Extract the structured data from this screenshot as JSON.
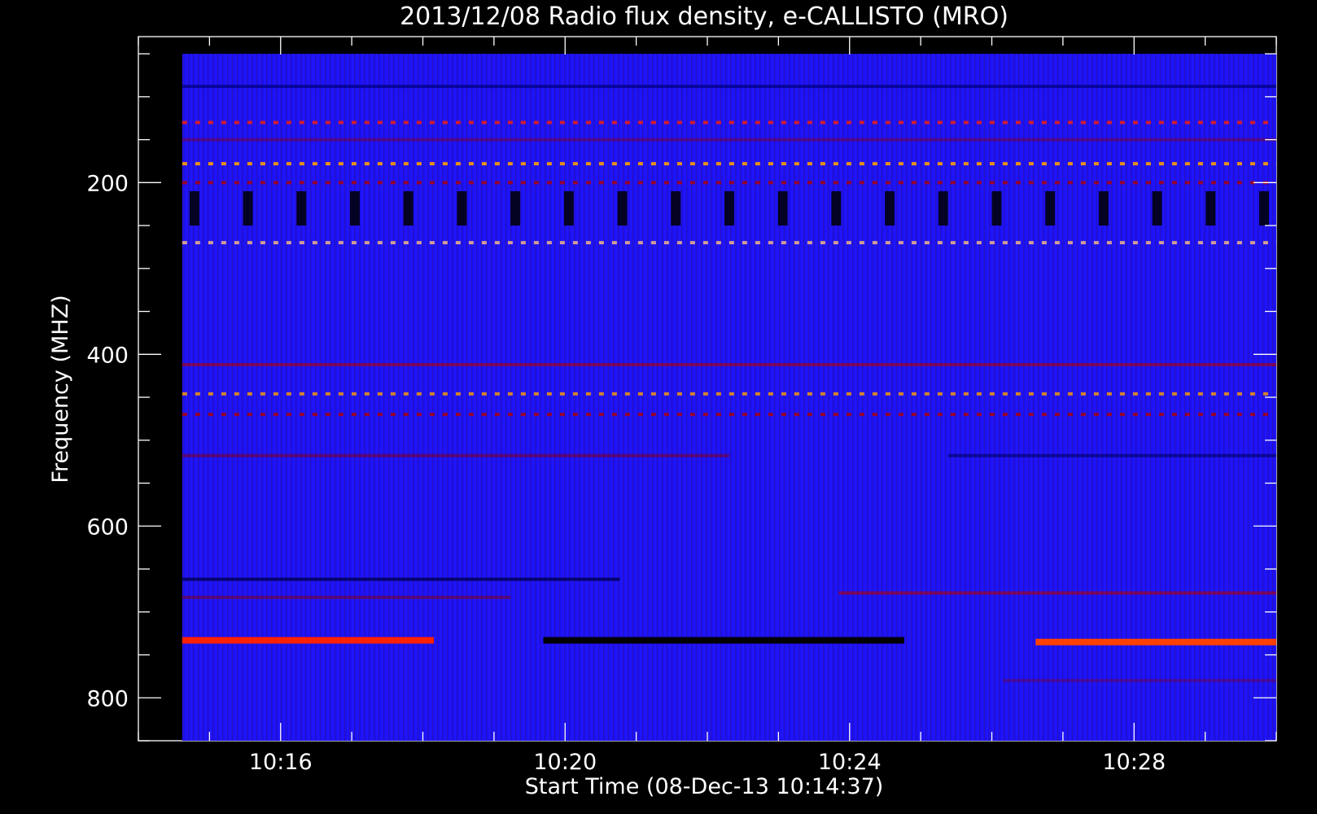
{
  "chart_data": {
    "type": "heatmap",
    "title": "2013/12/08  Radio flux density, e-CALLISTO (MRO)",
    "xlabel": "Start Time (08-Dec-13 10:14:37)",
    "ylabel": "Frequency (MHZ)",
    "x_ticks": [
      "10:16",
      "10:20",
      "10:24",
      "10:28"
    ],
    "y_ticks": [
      "200",
      "400",
      "600",
      "800"
    ],
    "x_range_minutes": [
      10.0,
      10.5
    ],
    "time_range": [
      "10:14:37",
      "10:30:00"
    ],
    "xlim": [
      "10:14:00",
      "10:30:00"
    ],
    "ylim": [
      850,
      30
    ],
    "data_freq_range": [
      850,
      50
    ],
    "y_reversed": true,
    "grid": false,
    "colormap": [
      "#000000",
      "#0000ff",
      "#b30000",
      "#ff2000",
      "#ffa000",
      "#ffffff"
    ],
    "background_color": "#1a10f0",
    "bands": [
      {
        "freq": 88,
        "color": "#00007a",
        "intensity": 0.7,
        "extent": [
          0,
          1
        ]
      },
      {
        "freq": 130,
        "color": "#ff2000",
        "intensity": 0.8,
        "extent": [
          0,
          1
        ],
        "dashed": true
      },
      {
        "freq": 150,
        "color": "#7a0030",
        "intensity": 0.5,
        "extent": [
          0,
          1
        ]
      },
      {
        "freq": 178,
        "color": "#ffa000",
        "intensity": 0.9,
        "extent": [
          0,
          1
        ],
        "dashed": true
      },
      {
        "freq": 200,
        "color": "#b30000",
        "intensity": 0.8,
        "extent": [
          0,
          1
        ],
        "dashed": true
      },
      {
        "freq": 270,
        "color": "#ffc080",
        "intensity": 0.8,
        "extent": [
          0,
          1
        ],
        "dashed": true
      },
      {
        "freq": 412,
        "color": "#b30000",
        "intensity": 0.6,
        "extent": [
          0,
          1
        ]
      },
      {
        "freq": 446,
        "color": "#ffa000",
        "intensity": 0.8,
        "extent": [
          0,
          1
        ],
        "dashed": true
      },
      {
        "freq": 470,
        "color": "#b30000",
        "intensity": 0.8,
        "extent": [
          0,
          1
        ],
        "dashed": true
      },
      {
        "freq": 518,
        "color": "#7a0030",
        "intensity": 0.6,
        "extent": [
          0,
          0.5
        ]
      },
      {
        "freq": 518,
        "color": "#000060",
        "intensity": 0.6,
        "extent": [
          0.7,
          1
        ]
      },
      {
        "freq": 662,
        "color": "#000050",
        "intensity": 0.8,
        "extent": [
          0,
          0.4
        ]
      },
      {
        "freq": 678,
        "color": "#b30000",
        "intensity": 0.6,
        "extent": [
          0.6,
          1
        ]
      },
      {
        "freq": 683,
        "color": "#7a0030",
        "intensity": 0.6,
        "extent": [
          0,
          0.3
        ]
      },
      {
        "freq": 733,
        "color": "#ff2000",
        "intensity": 1.0,
        "extent": [
          0,
          0.23
        ]
      },
      {
        "freq": 733,
        "color": "#000000",
        "intensity": 1.0,
        "extent": [
          0.33,
          0.66
        ]
      },
      {
        "freq": 735,
        "color": "#ff4000",
        "intensity": 1.0,
        "extent": [
          0.78,
          1
        ]
      },
      {
        "freq": 780,
        "color": "#7a0030",
        "intensity": 0.4,
        "extent": [
          0.75,
          1
        ]
      }
    ],
    "dark_bursts": {
      "freq_range": [
        210,
        250
      ],
      "count": 21,
      "color": "#000000"
    }
  }
}
